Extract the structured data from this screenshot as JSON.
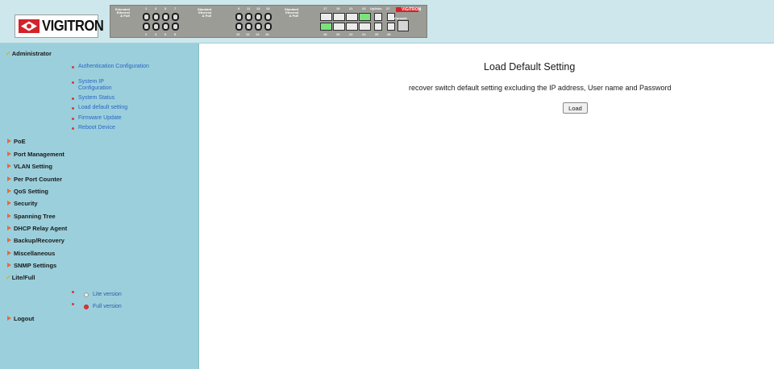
{
  "header": {
    "logo_text": "VIGITRON",
    "panel": {
      "brand": "VIGITRON",
      "group1_label": "Extended\nEthernet\n& PoE",
      "group2_label": "Standard\nEthernet\n& PoE",
      "group3_label": "Standard\nEthernet\n& PoE",
      "uplink_label": "Uplinks",
      "console_label": "Console",
      "top_nums_1": [
        "1",
        "3",
        "5",
        "7"
      ],
      "bottom_nums_1": [
        "2",
        "4",
        "6",
        "8"
      ],
      "top_nums_2": [
        "9",
        "11",
        "13",
        "15"
      ],
      "bottom_nums_2": [
        "10",
        "12",
        "14",
        "16"
      ],
      "top_nums_3": [
        "17",
        "19",
        "21",
        "23",
        "25",
        "27"
      ],
      "bottom_nums_3": [
        "18",
        "20",
        "22",
        "24",
        "26",
        "28"
      ]
    }
  },
  "sidebar": {
    "administrator": "Administrator",
    "admin_items": [
      "Authentication Configuration",
      "System IP Configuration",
      "System Status",
      "Load default setting",
      "Firmware Update",
      "Reboot Device"
    ],
    "menus": [
      "PoE",
      "Port Management",
      "VLAN Setting",
      "Per Port Counter",
      "QoS Setting",
      "Security",
      "Spanning Tree",
      "DHCP Relay Agent",
      "Backup/Recovery",
      "Miscellaneous",
      "SNMP Settings"
    ],
    "lite_full": "Lite/Full",
    "lite_version": "Lite version",
    "full_version": "Full version",
    "logout": "Logout"
  },
  "main": {
    "title": "Load Default Setting",
    "description": "recover switch default setting excluding the IP address, User name and Password",
    "load_button": "Load"
  },
  "colors": {
    "header_bg": "#cde7ec",
    "sidebar_bg": "#9bcfdc",
    "link": "#2a66c4",
    "brand_red": "#d3232a"
  }
}
